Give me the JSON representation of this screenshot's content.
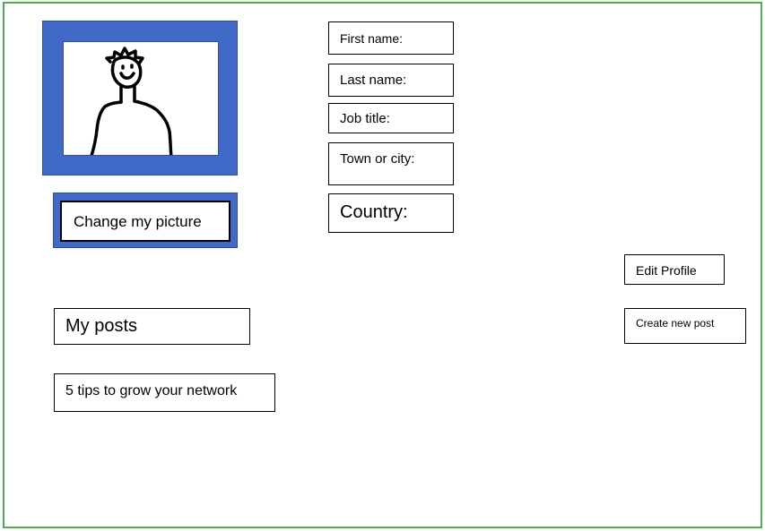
{
  "profile": {
    "change_picture_label": "Change my picture"
  },
  "fields": {
    "first_name": "First name:",
    "last_name": "Last name:",
    "job_title": "Job title:",
    "town_or_city": "Town or city:",
    "country": "Country:"
  },
  "actions": {
    "edit_profile": "Edit Profile",
    "create_new_post": "Create new post"
  },
  "posts": {
    "heading": "My posts",
    "items": [
      "5 tips to grow your network"
    ]
  },
  "colors": {
    "frame_border": "#4cae4c",
    "picture_frame": "#4169c8"
  }
}
